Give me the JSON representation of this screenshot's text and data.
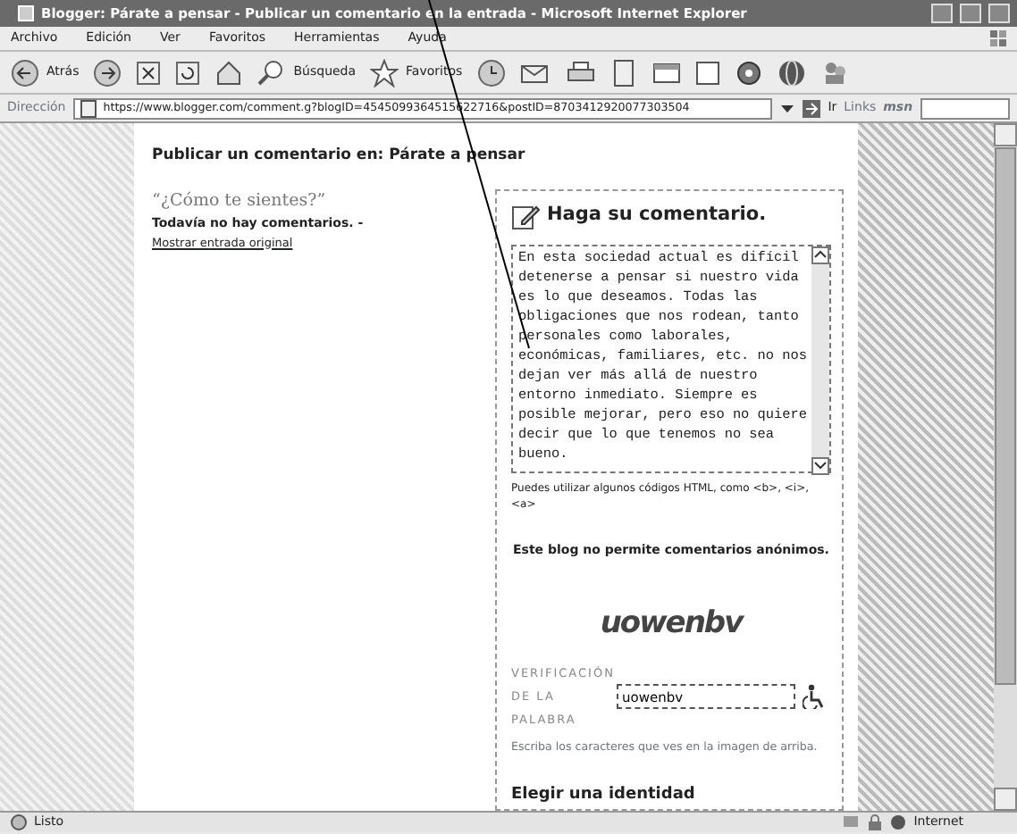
{
  "window": {
    "title": "Blogger: Párate a pensar - Publicar un comentario en la entrada - Microsoft Internet Explorer"
  },
  "menu": [
    "Archivo",
    "Edición",
    "Ver",
    "Favoritos",
    "Herramientas",
    "Ayuda"
  ],
  "toolbar": {
    "back": "Atrás",
    "search": "Búsqueda",
    "favorites": "Favoritos"
  },
  "address_bar": {
    "label": "Dirección",
    "url": "https://www.blogger.com/comment.g?blogID=4545099364515622716&postID=8703412920077303504",
    "go": "Ir",
    "links": "Links",
    "msn": "msn"
  },
  "page": {
    "heading": "Publicar un comentario en: Párate a pensar",
    "post_title": "“¿Cómo te sientes?”",
    "no_comments": "Todavía no hay comentarios. -",
    "show_post_link": "Mostrar entrada original",
    "form": {
      "title": "Haga su comentario.",
      "comment": "En esta sociedad actual es difícil detenerse a pensar si nuestro vida es lo que deseamos. Todas las obligaciones que nos rodean, tanto personales como laborales, económicas, familiares, etc. no nos dejan ver más allá de nuestro entorno inmediato. Siempre es posible mejorar, pero eso no quiere decir que lo que tenemos no sea bueno.",
      "html_hint": "Puedes utilizar algunos códigos HTML, como <b>, <i>, <a>",
      "anonymous_note": "Este blog no permite comentarios anónimos.",
      "captcha": "uowenbv",
      "verification_label": "VERIFICACIÓN DE LA PALABRA",
      "verification_value": "uowenbv",
      "verification_hint": "Escriba los caracteres que ves en la imagen de arriba.",
      "identity_heading": "Elegir una identidad"
    }
  },
  "status_bar": {
    "text": "Listo",
    "zone": "Internet"
  }
}
